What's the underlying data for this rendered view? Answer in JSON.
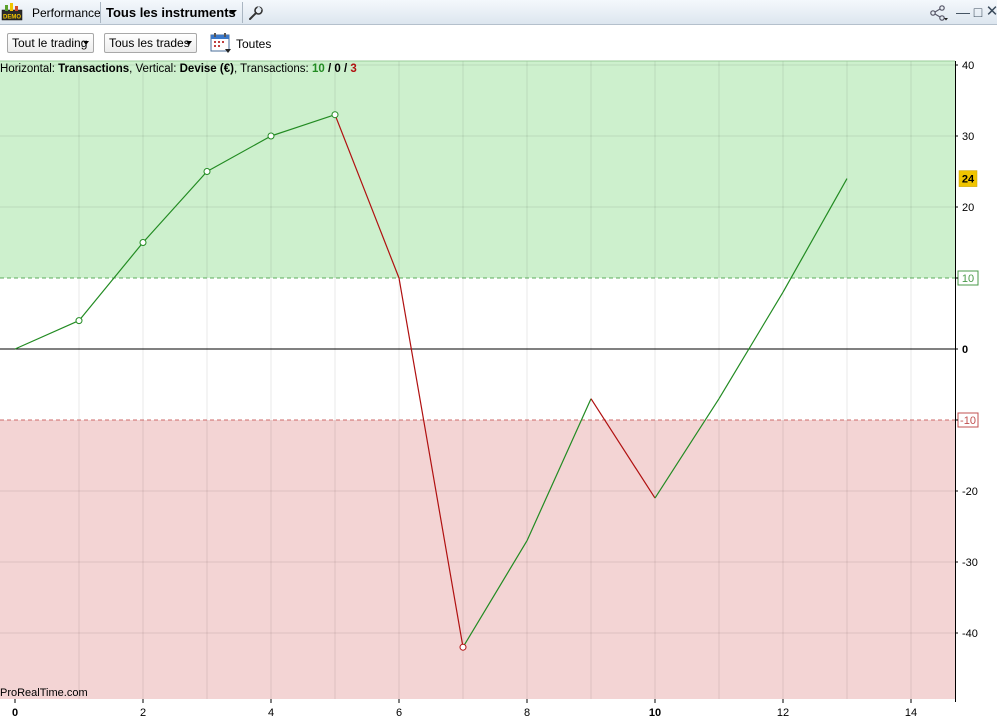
{
  "titlebar": {
    "badge": "DEMO",
    "performance_label": "Performance",
    "instrument_label": "Tous les instruments"
  },
  "toolbar": {
    "trading_filter": "Tout le trading",
    "trades_filter": "Tous les trades",
    "period_label": "Toutes"
  },
  "info": {
    "horizontal_prefix": "Horizontal: ",
    "horizontal_value": "Transactions",
    "vertical_prefix": ", Vertical: ",
    "vertical_value": "Devise (€)",
    "transactions_prefix": ", Transactions: ",
    "count_win": "10",
    "sep1": " / ",
    "count_neutral": "0",
    "sep2": " / ",
    "count_loss": "3"
  },
  "watermark": "ProRealTime.com",
  "colors": {
    "up_line": "#228b22",
    "down_line": "#b01010",
    "profit_zone": "#cdf0cd",
    "loss_zone": "#f3d4d4",
    "badge": "#f0c400"
  },
  "chart_data": {
    "type": "line",
    "xlabel": "Transactions",
    "ylabel": "Devise (€)",
    "x": [
      0,
      1,
      2,
      3,
      4,
      5,
      6,
      7,
      8,
      9,
      10,
      11,
      12,
      13
    ],
    "y": [
      0,
      4,
      15,
      25,
      30,
      33,
      10,
      -42,
      -27,
      -7,
      -21,
      -7,
      8,
      24
    ],
    "xlim": [
      0,
      14.7
    ],
    "ylim": [
      -49,
      41
    ],
    "x_ticks": [
      "0",
      "2",
      "4",
      "6",
      "8",
      "10",
      "12",
      "14"
    ],
    "y_ticks": [
      "40",
      "30",
      "20",
      "10",
      "0",
      "-10",
      "-20",
      "-30",
      "-40"
    ],
    "profit_threshold": 10,
    "loss_threshold": -10,
    "last_value_label": "24",
    "grid": true
  }
}
